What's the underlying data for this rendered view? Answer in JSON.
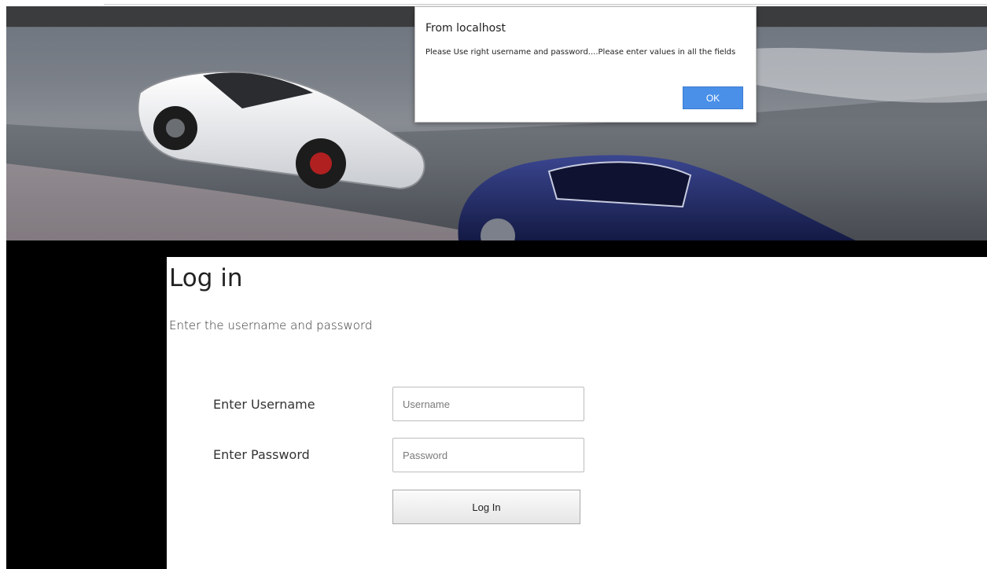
{
  "alert": {
    "title": "From localhost",
    "message": "Please Use right username and password....Please enter values in all the fields",
    "ok_label": "OK"
  },
  "login": {
    "title": "Log in",
    "subtitle": "Enter the username and password",
    "username_label": "Enter Username",
    "username_placeholder": "Username",
    "username_value": "",
    "password_label": "Enter Password",
    "password_placeholder": "Password",
    "password_value": "",
    "submit_label": "Log In"
  },
  "banner": {
    "image": "two sports cars racing on track header image"
  }
}
